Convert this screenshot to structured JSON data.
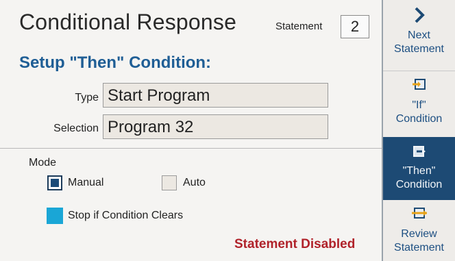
{
  "header": {
    "title": "Conditional Response",
    "statement_label": "Statement",
    "statement_value": "2"
  },
  "section": {
    "subtitle": "Setup \"Then\" Condition:"
  },
  "fields": {
    "type_label": "Type",
    "type_value": "Start Program",
    "selection_label": "Selection",
    "selection_value": "Program 32"
  },
  "mode": {
    "label": "Mode",
    "manual_label": "Manual",
    "manual_checked": true,
    "auto_label": "Auto",
    "auto_checked": false,
    "stop_label": "Stop if Condition Clears",
    "stop_checked": true
  },
  "status": {
    "text": "Statement Disabled"
  },
  "sidebar": {
    "next_line1": "Next",
    "next_line2": "Statement",
    "if_line1": "\"If\"",
    "if_line2": "Condition",
    "then_line1": "\"Then\"",
    "then_line2": "Condition",
    "review_line1": "Review",
    "review_line2": "Statement"
  },
  "colors": {
    "accent": "#1f5e95",
    "active_nav": "#1d4a74",
    "checkbox_fill": "#1aa6d6",
    "warning": "#b0222a",
    "icon_gold": "#e8a318"
  }
}
